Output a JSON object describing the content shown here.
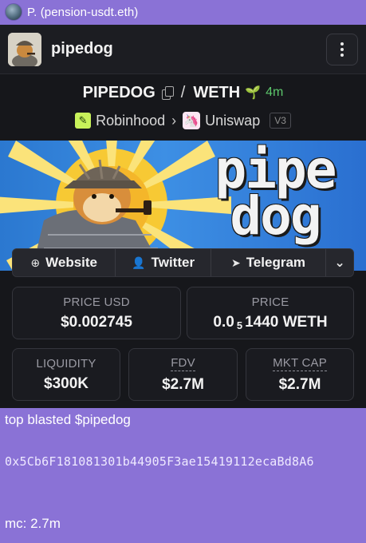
{
  "author": {
    "name": "P. (pension-usdt.eth)"
  },
  "card": {
    "token_name": "pipedog",
    "pair": {
      "base": "PIPEDOG",
      "quote": "WETH",
      "age": "4m"
    },
    "chain": {
      "name": "Robinhood",
      "dex": "Uniswap",
      "version": "V3"
    },
    "banner_title_1": "pipe",
    "banner_title_2": "dog",
    "links": {
      "website": "Website",
      "twitter": "Twitter",
      "telegram": "Telegram"
    },
    "stats": {
      "price_usd": {
        "label": "PRICE USD",
        "value": "$0.002745"
      },
      "price": {
        "label": "PRICE",
        "value_prefix": "0.0",
        "value_sub": "5",
        "value_suffix": "1440 WETH"
      },
      "liquidity": {
        "label": "LIQUIDITY",
        "value": "$300K"
      },
      "fdv": {
        "label": "FDV",
        "value": "$2.7M"
      },
      "mkt_cap": {
        "label": "MKT CAP",
        "value": "$2.7M"
      }
    }
  },
  "post": {
    "text": "top blasted $pipedog",
    "address": "0x5Cb6F181081301b44905F3ae15419112ecaBd8A6",
    "mc": "mc: 2.7m"
  },
  "colors": {
    "background": "#8a72d6",
    "card": "#16171b",
    "accent_green": "#5cc66b"
  }
}
